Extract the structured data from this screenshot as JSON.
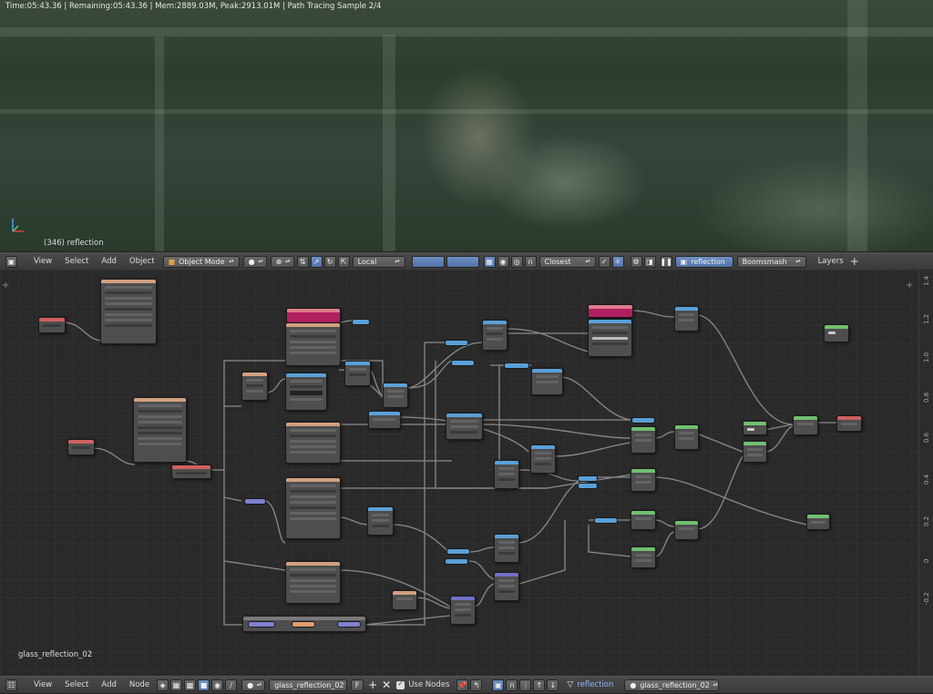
{
  "viewport": {
    "render_info": "Time:05:43.36 | Remaining:05:43.36 | Mem:2889.03M, Peak:2913.01M | Path Tracing Sample 2/4",
    "object_label": "(346) reflection"
  },
  "header_3d": {
    "menus": [
      "View",
      "Select",
      "Add",
      "Object"
    ],
    "mode": "Object Mode",
    "orientation": "Local",
    "snap_target": "Closest",
    "scene_name": "reflection",
    "render_layer": "Boomsmash",
    "layers_label": "Layers"
  },
  "node_editor": {
    "tree_name": "glass_reflection_02",
    "ruler_ticks": [
      "1.4",
      "1.2",
      "1.0",
      "0.8",
      "0.6",
      "0.4",
      "0.2",
      "0",
      "-0.2"
    ]
  },
  "header_node": {
    "menus": [
      "View",
      "Select",
      "Add",
      "Node"
    ],
    "material": "glass_reflection_02",
    "fake_user": "F",
    "use_nodes_label": "Use Nodes",
    "object_name": "reflection",
    "material_slot": "glass_reflection_02"
  },
  "colors": {
    "header_color": "#e07a8a",
    "input_color": "#d06060",
    "shader_color": "#70c070",
    "texture_color": "#d0a080",
    "vector_color": "#7070c8",
    "converter_color": "#5aa0d8"
  }
}
